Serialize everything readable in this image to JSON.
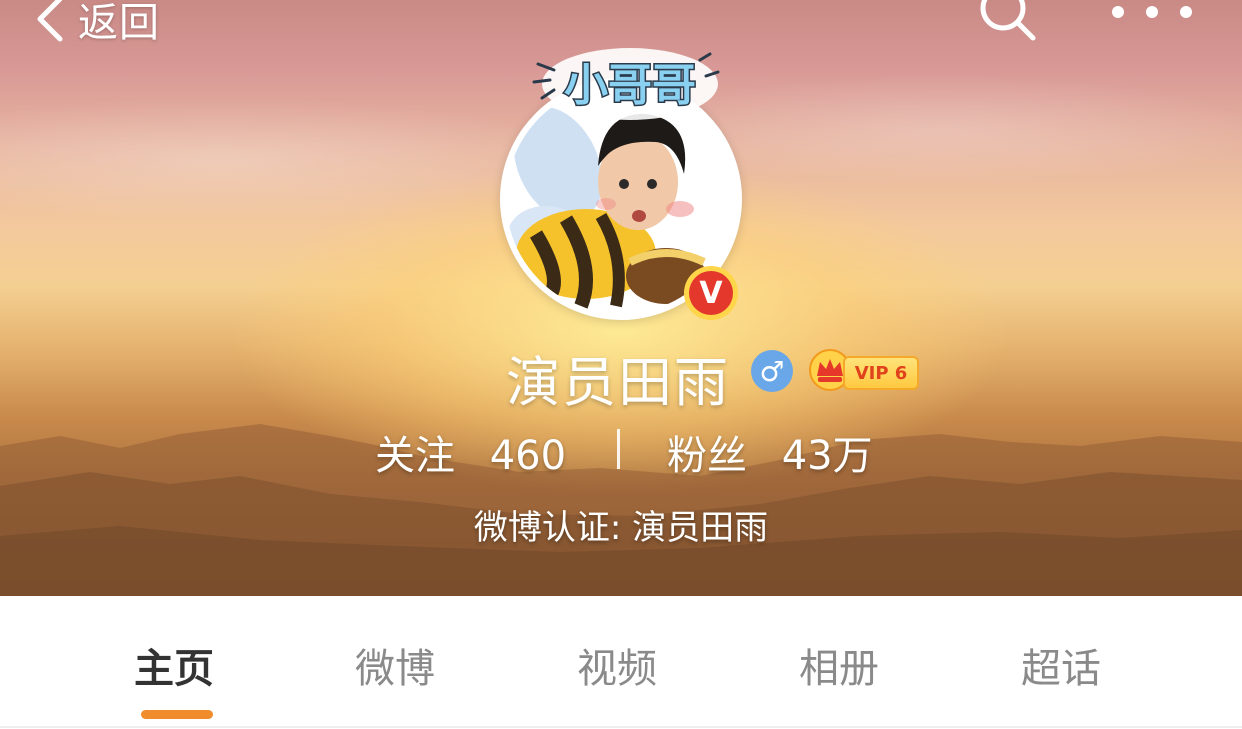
{
  "topbar": {
    "back_label": "返回",
    "icons": [
      "chevron-left-icon",
      "search-icon",
      "more-icon"
    ]
  },
  "avatar": {
    "sticker_text": "小哥哥",
    "badge_letter": "V",
    "badge_color": "#e3382b"
  },
  "profile": {
    "name": "演员田雨",
    "gender_symbol": "♂",
    "vip_label": "VIP 6",
    "follow_label": "关注",
    "follow_count": "460",
    "stat_divider": "|",
    "fans_label": "粉丝",
    "fans_count": "43万",
    "verification": "微博认证: 演员田雨"
  },
  "tabs": [
    {
      "label": "主页",
      "active": true
    },
    {
      "label": "微博",
      "active": false
    },
    {
      "label": "视频",
      "active": false
    },
    {
      "label": "相册",
      "active": false
    },
    {
      "label": "超话",
      "active": false
    }
  ],
  "colors": {
    "accent": "#f08c2b",
    "active_tab_text": "#333333",
    "inactive_tab_text": "#8a8a8a"
  }
}
